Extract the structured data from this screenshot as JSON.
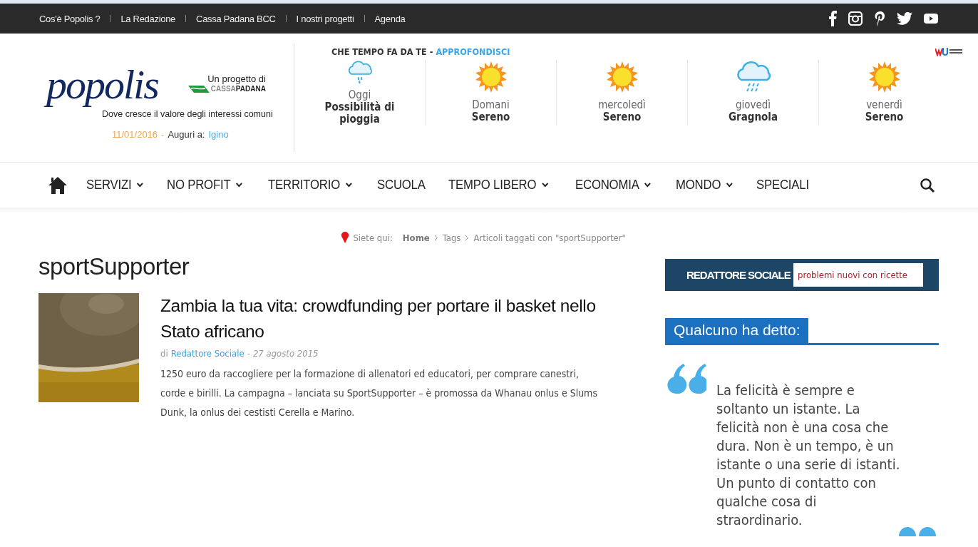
{
  "top_bar": {
    "links": [
      "Cos'è Popolis ?",
      "La Redazione",
      "Cassa Padana BCC",
      "I nostri progetti",
      "Agenda"
    ],
    "social": [
      {
        "kind": "facebook"
      },
      {
        "kind": "instagram"
      },
      {
        "kind": "pinterest"
      },
      {
        "kind": "twitter"
      },
      {
        "kind": "youtube"
      }
    ]
  },
  "header": {
    "logo": "popolis",
    "tagline": "Dove cresce il valore degli interessi comuni",
    "sponsor_intro": "Un progetto di",
    "sponsor_name_1": "CASSA",
    "sponsor_name_2": "PADANA",
    "date": "11/01/2016",
    "date_separator": "-",
    "greeting": "Auguri a:",
    "name_day": "Igino"
  },
  "weather": {
    "title": "CHE TEMPO FA DA TE",
    "separator": "-",
    "link": "APPROFONDISCI",
    "days": [
      {
        "day": "Oggi",
        "condition": "Possibilità di pioggia",
        "kind": "rain"
      },
      {
        "day": "Domani",
        "condition": "Sereno",
        "kind": "sun"
      },
      {
        "day": "mercoledì",
        "condition": "Sereno",
        "kind": "sun"
      },
      {
        "day": "giovedì",
        "condition": "Gragnola",
        "kind": "hail"
      },
      {
        "day": "venerdì",
        "condition": "Sereno",
        "kind": "sun"
      }
    ]
  },
  "nav": {
    "items": [
      {
        "label": "SERVIZI",
        "dropdown": true
      },
      {
        "label": "NO PROFIT",
        "dropdown": true
      },
      {
        "label": "TERRITORIO",
        "dropdown": true
      },
      {
        "label": "SCUOLA",
        "dropdown": false
      },
      {
        "label": "TEMPO LIBERO",
        "dropdown": true
      },
      {
        "label": "ECONOMIA",
        "dropdown": true
      },
      {
        "label": "MONDO",
        "dropdown": true
      },
      {
        "label": "SPECIALI",
        "dropdown": false
      }
    ]
  },
  "breadcrumb": {
    "intro": "Siete qui:",
    "items": [
      "Home",
      "Tags",
      "Articoli taggati con \"sportSupporter\""
    ]
  },
  "page_title": "sportSupporter",
  "articles": [
    {
      "title": "Zambia la tua vita: crowdfunding per portare il basket nello Stato africano",
      "by": "di",
      "author": "Redattore Sociale",
      "separator": "-",
      "date": "27 agosto 2015",
      "summary": "1250 euro da raccogliere per la formazione di allenatori ed educatori, per comprare canestri, corde e birilli. La campagna – lanciata su SportSupporter – è promossa da Whanau onlus e Slums Dunk, la onlus dei cestisti Cerella e Marino."
    }
  ],
  "sidebar": {
    "ticker": {
      "brand": "REDATTORE SOCIALE",
      "headline": "problemi nuovi con ricette"
    },
    "quote_title": "Qualcuno ha detto:",
    "quote": "La felicità è sempre e soltanto un istante. La felicità non è una cosa che dura. Non è un tempo, è un istante o una serie di istanti. Un punto di contatto con qualche cosa di straordinario."
  }
}
